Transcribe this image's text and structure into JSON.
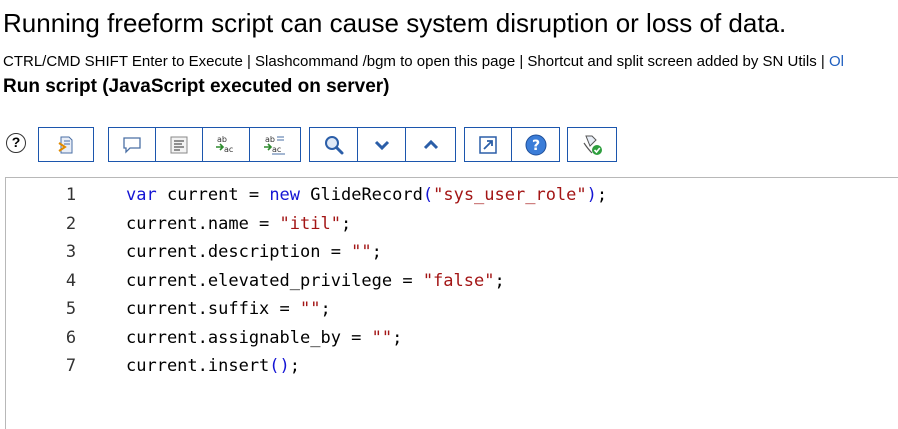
{
  "warning_text": "Running freeform script can cause system disruption or loss of data.",
  "hint": {
    "text": "CTRL/CMD SHIFT Enter to Execute | Slashcommand /bgm to open this page | Shortcut and split screen added by SN Utils | ",
    "link_fragment": "Ol"
  },
  "page_title": "Run script (JavaScript executed on server)",
  "help_symbol": "?",
  "toolbar": {
    "groups": [
      [
        "format-script-icon"
      ],
      [
        "comment-icon",
        "format-lines-icon",
        "replace-icon",
        "replace-all-icon"
      ],
      [
        "search-icon",
        "next-icon",
        "previous-icon"
      ],
      [
        "fullscreen-icon",
        "help-icon"
      ],
      [
        "syntax-check-icon"
      ]
    ]
  },
  "colors": {
    "toolbar_border": "#1c56ad",
    "keyword": "#1515d4",
    "string": "#a31515",
    "link": "#1f5fbf"
  },
  "editor": {
    "lines": [
      {
        "num": "1",
        "tokens": [
          [
            "kw",
            "var"
          ],
          [
            "plain",
            " current = "
          ],
          [
            "kw",
            "new"
          ],
          [
            "plain",
            " GlideRecord"
          ],
          [
            "paren",
            "("
          ],
          [
            "str",
            "\"sys_user_role\""
          ],
          [
            "paren",
            ")"
          ],
          [
            "plain",
            ";"
          ]
        ]
      },
      {
        "num": "2",
        "tokens": [
          [
            "plain",
            "current.name = "
          ],
          [
            "str",
            "\"itil\""
          ],
          [
            "plain",
            ";"
          ]
        ]
      },
      {
        "num": "3",
        "tokens": [
          [
            "plain",
            "current.description = "
          ],
          [
            "str",
            "\"\""
          ],
          [
            "plain",
            ";"
          ]
        ]
      },
      {
        "num": "4",
        "tokens": [
          [
            "plain",
            "current.elevated_privilege = "
          ],
          [
            "str",
            "\"false\""
          ],
          [
            "plain",
            ";"
          ]
        ]
      },
      {
        "num": "5",
        "tokens": [
          [
            "plain",
            "current.suffix = "
          ],
          [
            "str",
            "\"\""
          ],
          [
            "plain",
            ";"
          ]
        ]
      },
      {
        "num": "6",
        "tokens": [
          [
            "plain",
            "current.assignable_by = "
          ],
          [
            "str",
            "\"\""
          ],
          [
            "plain",
            ";"
          ]
        ]
      },
      {
        "num": "7",
        "tokens": [
          [
            "plain",
            "current.insert"
          ],
          [
            "paren",
            "()"
          ],
          [
            "plain",
            ";"
          ]
        ]
      }
    ]
  }
}
